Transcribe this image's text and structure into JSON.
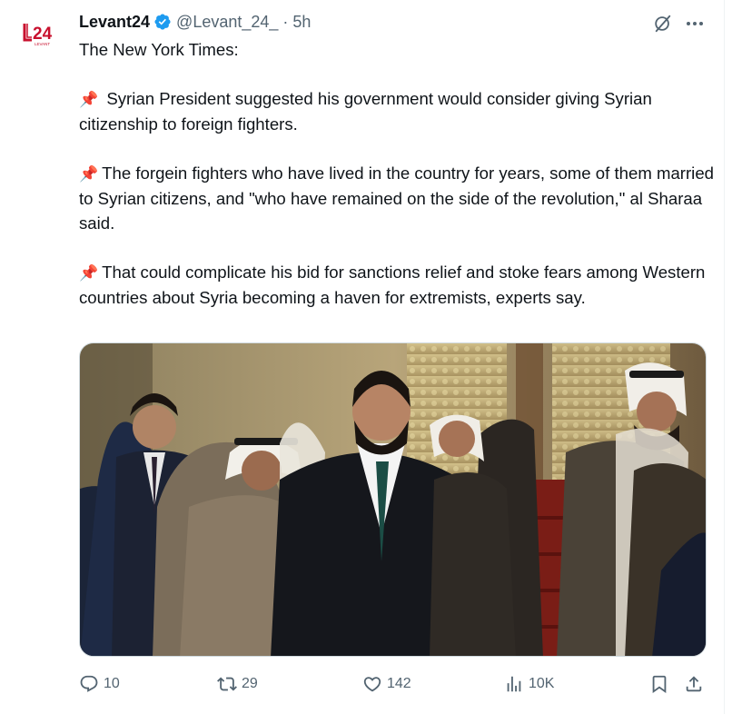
{
  "tweet": {
    "author": {
      "display_name": "Levant24",
      "handle": "@Levant_24_",
      "verified_icon": "verified-badge-icon",
      "avatar_logo_text": "L24",
      "avatar_logo_subtext": "LEVANT"
    },
    "separator": "·",
    "timestamp": "5h",
    "header_icons": [
      "grok-icon",
      "more-icon"
    ],
    "text": {
      "intro": "The New York Times:",
      "pin_emoji": "📌",
      "para1": "Syrian President suggested his government would consider giving Syrian citizenship to foreign fighters.",
      "para2": "The forgein fighters who have lived in the country for years, some of them married to Syrian citizens, and \"who have remained on the side of the revolution,\" al Sharaa said.",
      "para3": "That could complicate his bid for sanctions relief and stoke fears among Western countries about Syria becoming a haven for extremists, experts say."
    },
    "media": {
      "type": "photo"
    },
    "actions": {
      "replies": "10",
      "retweets": "29",
      "likes": "142",
      "views": "10K"
    },
    "colors": {
      "text": "#0f1419",
      "secondary": "#536471",
      "verified": "#1d9bf0",
      "logo_red": "#c8102e",
      "border": "#cfd9de"
    }
  }
}
